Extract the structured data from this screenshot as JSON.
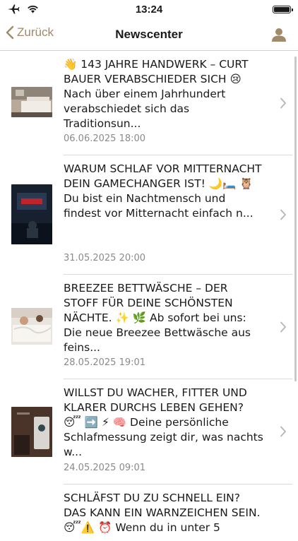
{
  "status": {
    "time": "13:24",
    "icons": [
      "airplane-icon",
      "wifi-icon",
      "battery-icon"
    ]
  },
  "nav": {
    "back_label": "Zurück",
    "title": "Newscenter",
    "accent_color": "#a08a6a",
    "profile_icon": "person-icon"
  },
  "news": [
    {
      "text": "👋 143 JAHRE HANDWERK – CURT BAUER VERABSCHIEDER SICH 😢 Nach über einem Jahrhundert verabschiedet sich das Traditionsun...",
      "date": "06.06.2025 18:00",
      "thumb": "bedroom-photo"
    },
    {
      "text": "WARUM SCHLAF VOR MITTERNACHT DEIN GAMECHANGER IST! 🌙🛏️ 🦉 Du bist ein Nachtmensch und findest vor Mitternacht einfach n...",
      "date": "31.05.2025 20:00",
      "thumb": "netflix-tv-photo"
    },
    {
      "text": "BREEZEE BETTWÄSCHE – DER STOFF FÜR DEINE SCHÖNSTEN NÄCHTE. ✨ 🌿 Ab sofort bei uns: Die neue Breezee Bettwäsche aus feins...",
      "date": "28.05.2025 19:01",
      "thumb": "bedding-photo"
    },
    {
      "text": "WILLST DU WACHER, FITTER UND KLARER DURCHS LEBEN GEHEN? 😴 ➡️ ⚡ 🧠 Deine persönliche Schlafmessung zeigt dir, was nachts w...",
      "date": "24.05.2025 09:01",
      "thumb": "sleep-measurement-photo"
    },
    {
      "text": "SCHLÄFST DU ZU SCHNELL EIN? DAS KANN EIN WARNZEICHEN SEIN. 😴⚠️ ⏰ Wenn du in unter 5",
      "date": "",
      "thumb": ""
    }
  ]
}
